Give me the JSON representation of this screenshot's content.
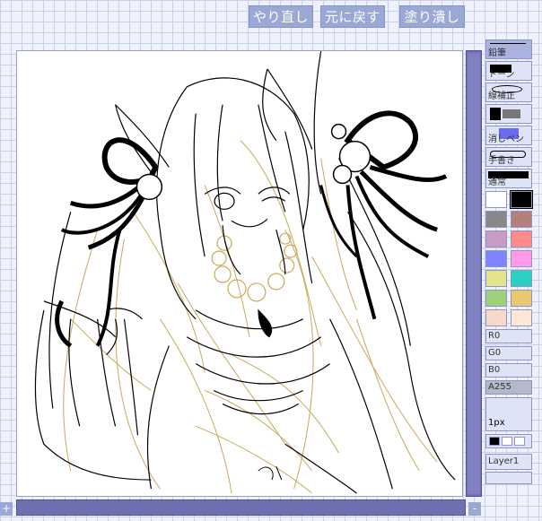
{
  "toolbar": {
    "redo_label": "やり直し",
    "undo_label": "元に戻す",
    "fill_label": "塗り潰し"
  },
  "zoom": {
    "in_label": "+",
    "out_label": "-"
  },
  "tools": {
    "pencil": "鉛筆",
    "tone": "トーン",
    "line": "線補正",
    "fill": "",
    "eraser": "消しペン",
    "handwrite": "手書き",
    "normal": "通常"
  },
  "palette": [
    "#ffffff",
    "#000000",
    "#888888",
    "#b47f7a",
    "#c89ac4",
    "#ff8a8a",
    "#7f82ff",
    "#ff9be8",
    "#e3e38a",
    "#2ad0c4",
    "#9ed17a",
    "#e8c870",
    "#f6d9c6",
    "#fde8d8"
  ],
  "colors": {
    "r": "R0",
    "g": "G0",
    "b": "B0",
    "a": "A255"
  },
  "brush_size": "1px",
  "layer": {
    "name": "Layer1"
  }
}
